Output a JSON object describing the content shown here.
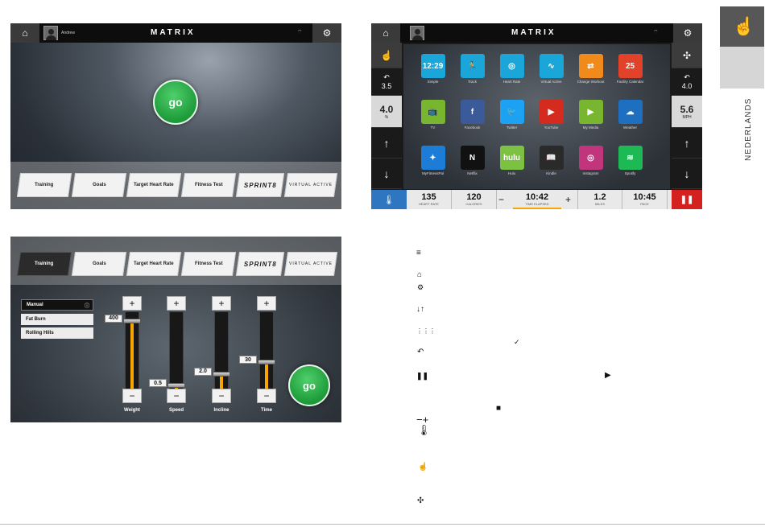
{
  "language_tab": "NEDERLANDS",
  "screen1": {
    "home_icon": "home-icon",
    "username": "Andrew",
    "brand": "MATRIX",
    "go_label": "go",
    "tiles": [
      "Training",
      "Goals",
      "Target Heart Rate",
      "Fitness Test",
      "SPRINT8",
      "VIRTUAL ACTIVE"
    ]
  },
  "screen2": {
    "brand": "MATRIX",
    "left": {
      "back_value": "3.5",
      "incline_value": "4.0",
      "incline_unit": "%"
    },
    "right": {
      "back_value": "4.0",
      "speed_value": "5.6",
      "speed_unit": "MPH"
    },
    "apps": [
      {
        "label": "Simple",
        "glyph": "12:29",
        "color": "#1aa6d9"
      },
      {
        "label": "Track",
        "glyph": "🏃",
        "color": "#1aa6d9"
      },
      {
        "label": "Heart Rate",
        "glyph": "◎",
        "color": "#1aa6d9"
      },
      {
        "label": "Virtual Active",
        "glyph": "∿",
        "color": "#1aa6d9"
      },
      {
        "label": "Change Workout",
        "glyph": "⇄",
        "color": "#f08a1a"
      },
      {
        "label": "Facility Calendar",
        "glyph": "25",
        "color": "#e2412a"
      },
      {
        "label": "TV",
        "glyph": "📺",
        "color": "#79b62f"
      },
      {
        "label": "Facebook",
        "glyph": "f",
        "color": "#3b5a9a"
      },
      {
        "label": "Twitter",
        "glyph": "🐦",
        "color": "#1da1f2"
      },
      {
        "label": "YouTube",
        "glyph": "▶",
        "color": "#d52b1e"
      },
      {
        "label": "My Media",
        "glyph": "▶",
        "color": "#79b62f"
      },
      {
        "label": "Weather",
        "glyph": "☁",
        "color": "#1f6fc1"
      },
      {
        "label": "MyFitnessPal",
        "glyph": "✦",
        "color": "#1c7cd6"
      },
      {
        "label": "Netflix",
        "glyph": "N",
        "color": "#111111"
      },
      {
        "label": "Hulu",
        "glyph": "hulu",
        "color": "#7cc142"
      },
      {
        "label": "Kindle",
        "glyph": "📖",
        "color": "#2a2a2a"
      },
      {
        "label": "Instagram",
        "glyph": "◎",
        "color": "#c1357d"
      },
      {
        "label": "Spotify",
        "glyph": "≋",
        "color": "#1db954"
      }
    ],
    "stats": {
      "heart_rate": {
        "value": "135",
        "label": "HEART RATE"
      },
      "calories": {
        "value": "120",
        "label": "CALORIES"
      },
      "time_elapsed": {
        "value": "10:42",
        "label": "TIME ELAPSED"
      },
      "miles": {
        "value": "1.2",
        "label": "MILES"
      },
      "pace": {
        "value": "10:45",
        "label": "PACE"
      }
    },
    "minus": "−",
    "plus": "+"
  },
  "screen3": {
    "tiles": [
      "Training",
      "Goals",
      "Target Heart Rate",
      "Fitness Test",
      "SPRINT8",
      "VIRTUAL ACTIVE"
    ],
    "workouts": [
      "Manual",
      "Fat Burn",
      "Rolling Hills"
    ],
    "sliders": [
      {
        "name": "Weight",
        "value": "400",
        "level": 0.88
      },
      {
        "name": "Speed",
        "value": "0.5",
        "level": 0.05
      },
      {
        "name": "Incline",
        "value": "2.0",
        "level": 0.2
      },
      {
        "name": "Time",
        "value": "30",
        "level": 0.35
      }
    ],
    "go_label": "go",
    "plus": "+",
    "minus": "−"
  },
  "legend_icons": [
    "menu-icon",
    "home-icon",
    "gear-icon",
    "arrow-down-up-icon",
    "grid-icon",
    "back-icon",
    "pause-icon",
    "minus-plus-icon",
    "cooling-icon",
    "hand-touch-icon",
    "fan-icon"
  ]
}
